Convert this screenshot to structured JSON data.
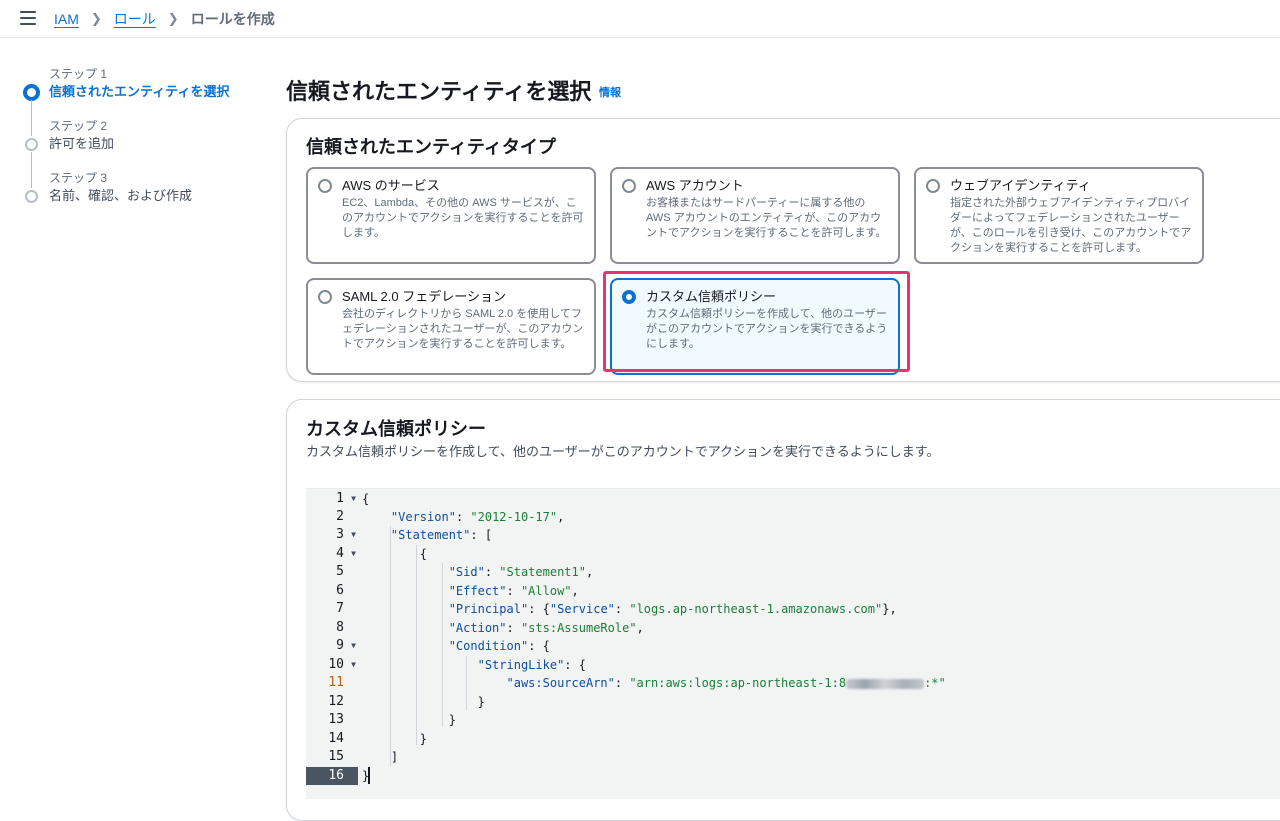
{
  "breadcrumb": {
    "items": [
      "IAM",
      "ロール",
      "ロールを作成"
    ]
  },
  "steps": [
    {
      "number": "ステップ 1",
      "title": "信頼されたエンティティを選択",
      "active": true
    },
    {
      "number": "ステップ 2",
      "title": "許可を追加",
      "active": false
    },
    {
      "number": "ステップ 3",
      "title": "名前、確認、および作成",
      "active": false
    }
  ],
  "page": {
    "title": "信頼されたエンティティを選択",
    "info_link": "情報"
  },
  "entity_type": {
    "heading": "信頼されたエンティティタイプ",
    "selected": "カスタム信頼ポリシー",
    "options": [
      {
        "title": "AWS のサービス",
        "description": "EC2、Lambda、その他の AWS サービスが、このアカウントでアクションを実行することを許可します。"
      },
      {
        "title": "AWS アカウント",
        "description": "お客様またはサードパーティーに属する他の AWS アカウントのエンティティが、このアカウントでアクションを実行することを許可します。"
      },
      {
        "title": "ウェブアイデンティティ",
        "description": "指定された外部ウェブアイデンティティプロバイダーによってフェデレーションされたユーザーが、このロールを引き受け、このアカウントでアクションを実行することを許可します。"
      },
      {
        "title": "SAML 2.0 フェデレーション",
        "description": "会社のディレクトリから SAML 2.0 を使用してフェデレーションされたユーザーが、このアカウントでアクションを実行することを許可します。"
      },
      {
        "title": "カスタム信頼ポリシー",
        "description": "カスタム信頼ポリシーを作成して、他のユーザーがこのアカウントでアクションを実行できるようにします。"
      }
    ]
  },
  "custom_policy": {
    "heading": "カスタム信頼ポリシー",
    "description": "カスタム信頼ポリシーを作成して、他のユーザーがこのアカウントでアクションを実行できるようにします。",
    "line_numbers": [
      "1",
      "2",
      "3",
      "4",
      "5",
      "6",
      "7",
      "8",
      "9",
      "10",
      "11",
      "12",
      "13",
      "14",
      "15",
      "16"
    ],
    "code": {
      "l1": "{",
      "version_key": "\"Version\"",
      "version_val": "\"2012-10-17\"",
      "statement_key": "\"Statement\"",
      "sid_key": "\"Sid\"",
      "sid_val": "\"Statement1\"",
      "effect_key": "\"Effect\"",
      "effect_val": "\"Allow\"",
      "principal_key": "\"Principal\"",
      "service_key": "\"Service\"",
      "service_val": "\"logs.ap-northeast-1.amazonaws.com\"",
      "action_key": "\"Action\"",
      "action_val": "\"sts:AssumeRole\"",
      "condition_key": "\"Condition\"",
      "stringlike_key": "\"StringLike\"",
      "sourcearn_key": "\"aws:SourceArn\"",
      "sourcearn_val_prefix": "\"arn:aws:logs:ap-northeast-1:8",
      "sourcearn_val_suffix": ":*\""
    }
  }
}
